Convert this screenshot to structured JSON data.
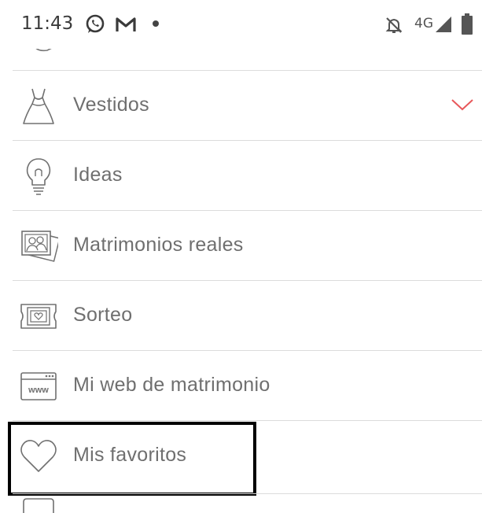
{
  "status_bar": {
    "time": "11:43",
    "network": "4G",
    "icons": [
      "whatsapp-icon",
      "gmail-icon",
      "notification-dot",
      "notifications-off-icon",
      "signal-icon",
      "battery-icon"
    ]
  },
  "menu": {
    "items": [
      {
        "label": "Vestidos",
        "icon": "dress-icon",
        "expandable": true
      },
      {
        "label": "Ideas",
        "icon": "lightbulb-icon"
      },
      {
        "label": "Matrimonios reales",
        "icon": "photos-icon"
      },
      {
        "label": "Sorteo",
        "icon": "ticket-icon"
      },
      {
        "label": "Mi web de matrimonio",
        "icon": "www-icon"
      },
      {
        "label": "Mis favoritos",
        "icon": "heart-icon",
        "highlighted": true
      }
    ]
  },
  "colors": {
    "accent": "#e8575a",
    "text": "#6f6f6f",
    "divider": "#dcdcdc"
  }
}
